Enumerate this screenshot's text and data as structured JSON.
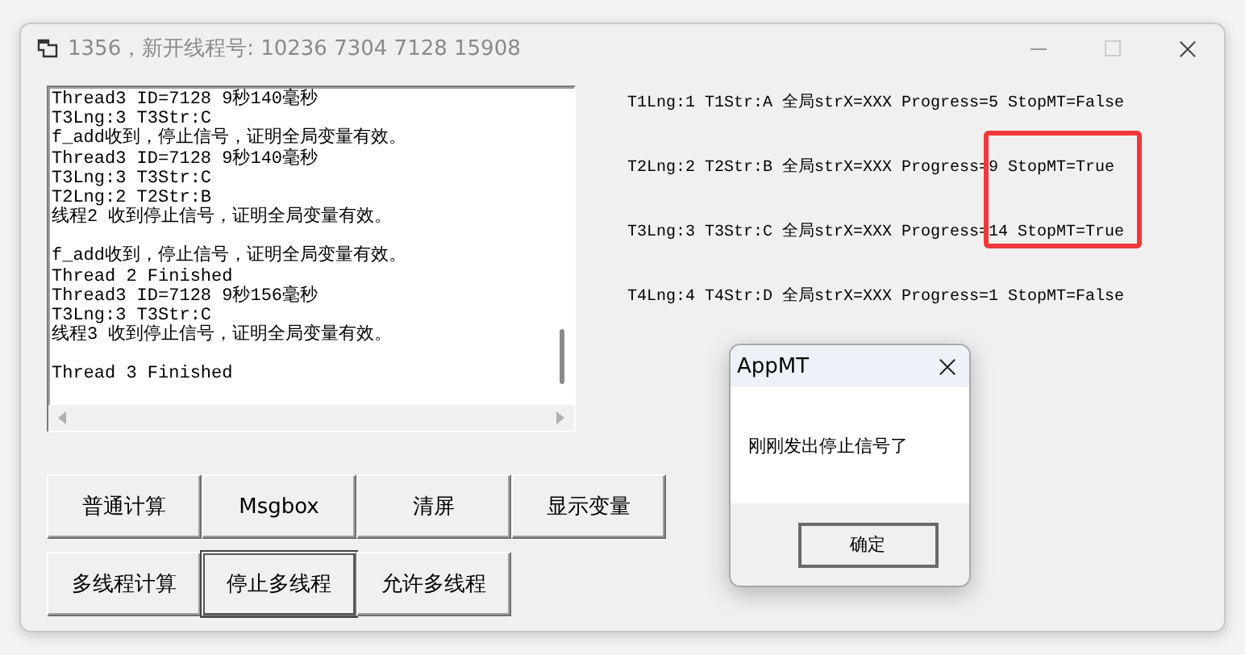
{
  "window": {
    "title": "1356，新开线程号: 10236 7304 7128 15908"
  },
  "log": {
    "blocks": [
      [
        "Thread3 ID=7128 9秒140毫秒",
        "T3Lng:3 T3Str:C",
        "f_add收到，停止信号，证明全局变量有效。",
        "Thread3 ID=7128 9秒140毫秒",
        "T3Lng:3 T3Str:C",
        "T2Lng:2 T2Str:B",
        "线程2 收到停止信号，证明全局变量有效。"
      ],
      [
        "f_add收到，停止信号，证明全局变量有效。",
        "Thread 2 Finished",
        "Thread3 ID=7128 9秒156毫秒",
        "T3Lng:3 T3Str:C",
        "线程3 收到停止信号，证明全局变量有效。"
      ],
      [
        "Thread 3 Finished"
      ]
    ]
  },
  "status_lines": [
    {
      "text": "T1Lng:1 T1Str:A 全局strX=XXX Progress=5 StopMT=False"
    },
    {
      "text": "T2Lng:2 T2Str:B 全局strX=XXX Progress=9 StopMT=True"
    },
    {
      "text": "T3Lng:3 T3Str:C 全局strX=XXX Progress=14 StopMT=True"
    },
    {
      "text": "T4Lng:4 T4Str:D 全局strX=XXX Progress=1 StopMT=False"
    }
  ],
  "button_rows": [
    [
      {
        "label": "普通计算",
        "focused": false
      },
      {
        "label": "Msgbox",
        "focused": false
      },
      {
        "label": "清屏",
        "focused": false
      },
      {
        "label": "显示变量",
        "focused": false
      }
    ],
    [
      {
        "label": "多线程计算",
        "focused": false
      },
      {
        "label": "停止多线程",
        "focused": true
      },
      {
        "label": "允许多线程",
        "focused": false
      }
    ]
  ],
  "dialog": {
    "title": "AppMT",
    "message": "刚刚发出停止信号了",
    "button": "确定"
  }
}
